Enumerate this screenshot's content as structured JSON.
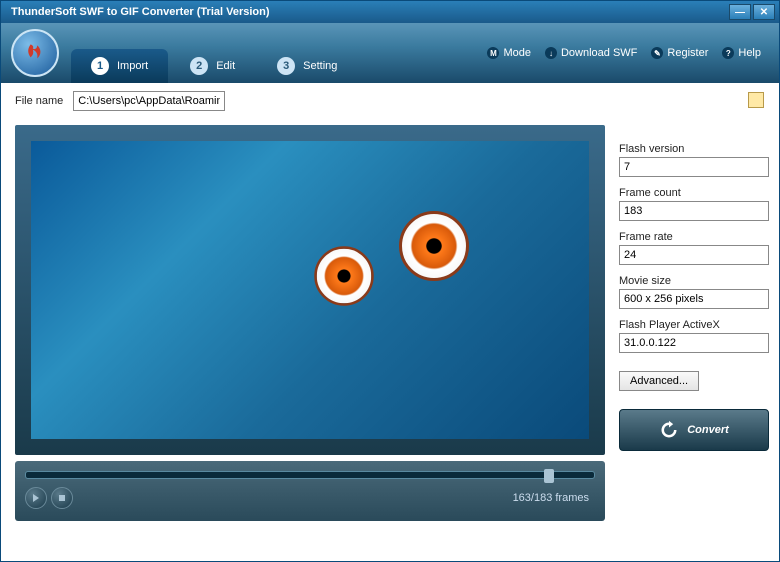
{
  "window": {
    "title": "ThunderSoft SWF to GIF Converter (Trial Version)"
  },
  "tabs": [
    {
      "num": "1",
      "label": "Import",
      "active": true
    },
    {
      "num": "2",
      "label": "Edit",
      "active": false
    },
    {
      "num": "3",
      "label": "Setting",
      "active": false
    }
  ],
  "topLinks": {
    "mode": {
      "icon": "M",
      "label": "Mode"
    },
    "download": {
      "icon": "↓",
      "label": "Download SWF"
    },
    "register": {
      "icon": "✎",
      "label": "Register"
    },
    "help": {
      "icon": "?",
      "label": "Help"
    }
  },
  "file": {
    "label": "File name",
    "path": "C:\\Users\\pc\\AppData\\Roaming\\ThunderSoft\\SWF to GIF Converter\\Sample.swf"
  },
  "player": {
    "frameStatus": "163/183 frames"
  },
  "info": {
    "flashVersion": {
      "label": "Flash version",
      "value": "7"
    },
    "frameCount": {
      "label": "Frame count",
      "value": "183"
    },
    "frameRate": {
      "label": "Frame rate",
      "value": "24"
    },
    "movieSize": {
      "label": "Movie size",
      "value": "600 x 256 pixels"
    },
    "activeX": {
      "label": "Flash Player ActiveX",
      "value": "31.0.0.122"
    },
    "advanced": "Advanced..."
  },
  "convert": "Convert"
}
